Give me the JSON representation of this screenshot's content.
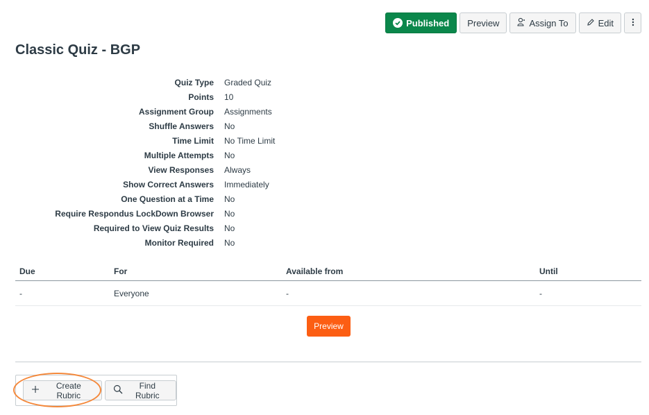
{
  "toolbar": {
    "published_label": "Published",
    "preview_label": "Preview",
    "assign_label": "Assign To",
    "edit_label": "Edit"
  },
  "quiz": {
    "title": "Classic Quiz - BGP"
  },
  "details": [
    {
      "label": "Quiz Type",
      "value": "Graded Quiz"
    },
    {
      "label": "Points",
      "value": "10"
    },
    {
      "label": "Assignment Group",
      "value": "Assignments"
    },
    {
      "label": "Shuffle Answers",
      "value": "No"
    },
    {
      "label": "Time Limit",
      "value": "No Time Limit"
    },
    {
      "label": "Multiple Attempts",
      "value": "No"
    },
    {
      "label": "View Responses",
      "value": "Always"
    },
    {
      "label": "Show Correct Answers",
      "value": "Immediately"
    },
    {
      "label": "One Question at a Time",
      "value": "No"
    },
    {
      "label": "Require Respondus LockDown Browser",
      "value": "No"
    },
    {
      "label": "Required to View Quiz Results",
      "value": "No"
    },
    {
      "label": "Monitor Required",
      "value": "No"
    }
  ],
  "dates": {
    "headers": [
      "Due",
      "For",
      "Available from",
      "Until"
    ],
    "rows": [
      [
        "-",
        "Everyone",
        "-",
        "-"
      ]
    ]
  },
  "preview_button": "Preview",
  "rubric": {
    "create_label": "Create Rubric",
    "find_label": "Find Rubric"
  },
  "colors": {
    "published": "#0b874b",
    "preview": "#fc5e13",
    "highlight": "#f4883a"
  }
}
